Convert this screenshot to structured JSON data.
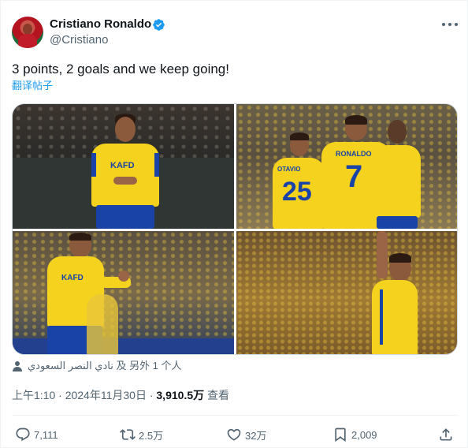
{
  "author": {
    "name": "Cristiano Ronaldo",
    "handle": "@Cristiano",
    "verified": true
  },
  "tweet": {
    "text": "3 points, 2 goals and we keep going!",
    "translate_label": "翻译帖子"
  },
  "media": {
    "photos": [
      {
        "jersey_text": "KAFD"
      },
      {
        "jersey_numbers": [
          "25",
          "7"
        ],
        "jersey_names": [
          "OTAVIO",
          "RONALDO"
        ]
      },
      {
        "jersey_text": "KAFD"
      },
      {
        "jersey_text": ""
      }
    ]
  },
  "tags": {
    "text": "نادي النصر السعودي 及 另外 1 个人"
  },
  "meta": {
    "time": "上午1:10 · 2024年11月30日 · ",
    "views_count": "3,910.5万",
    "views_label": " 查看"
  },
  "actions": {
    "replies": "7,111",
    "reposts": "2.5万",
    "likes": "32万",
    "bookmarks": "2,009"
  },
  "colors": {
    "accent": "#1d9bf0",
    "text": "#0f1419",
    "secondary": "#536471",
    "jersey": "#f4d21e",
    "jersey_blue": "#1a43a8"
  }
}
